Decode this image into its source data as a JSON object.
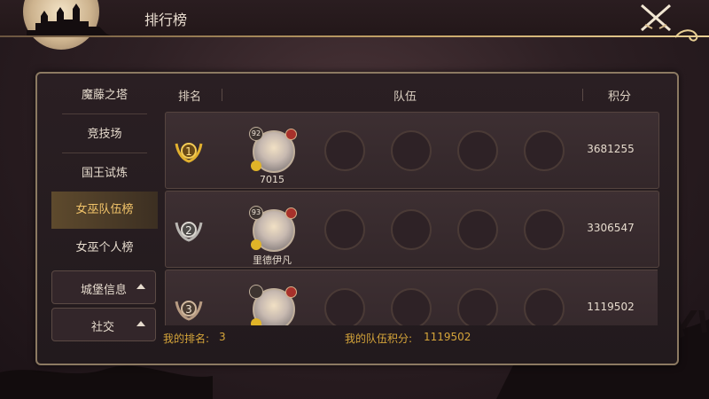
{
  "header": {
    "title": "排行榜"
  },
  "menu": {
    "items": [
      {
        "label": "魔藤之塔"
      },
      {
        "label": "竞技场"
      },
      {
        "label": "国王试炼"
      },
      {
        "label": "女巫队伍榜",
        "active": true
      },
      {
        "label": "女巫个人榜"
      }
    ],
    "buttons": [
      {
        "label": "城堡信息"
      },
      {
        "label": "社交"
      }
    ]
  },
  "table": {
    "headers": {
      "rank": "排名",
      "team": "队伍",
      "score": "积分"
    },
    "rows": [
      {
        "rank": 1,
        "hero_level": "92",
        "name": "7015",
        "score": "3681255"
      },
      {
        "rank": 2,
        "hero_level": "93",
        "name": "里德伊凡",
        "score": "3306547"
      },
      {
        "rank": 3,
        "hero_level": "",
        "name": "",
        "score": "1119502"
      }
    ]
  },
  "footer": {
    "my_rank_label": "我的排名:",
    "my_rank_value": "3",
    "my_score_label": "我的队伍积分:",
    "my_score_value": "1119502"
  },
  "colors": {
    "accent": "#d6a53a",
    "active_menu": "#f2c46a",
    "border": "#8c7a62"
  },
  "icons": {
    "close": "crossed-swords-close-icon",
    "rank1": "gold-laurel-rank-1-icon",
    "rank2": "silver-laurel-rank-2-icon",
    "rank3": "bronze-laurel-rank-3-icon",
    "collapse": "triangle-up-icon"
  }
}
